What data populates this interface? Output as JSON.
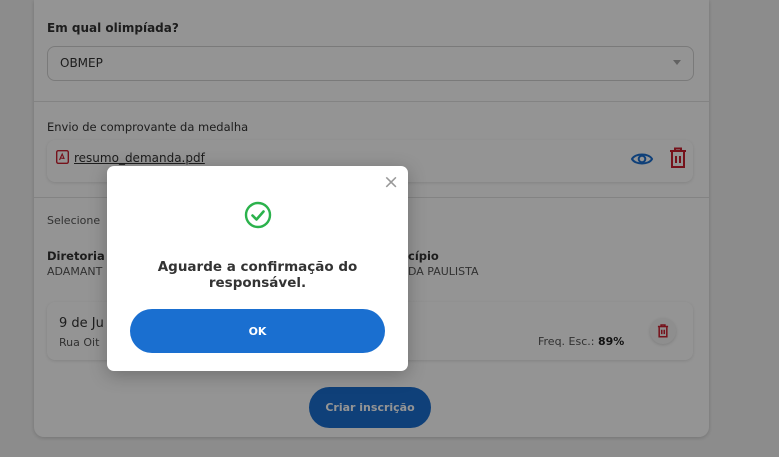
{
  "form": {
    "olympiad_label": "Em qual olimpíada?",
    "olympiad_value": "OBMEP",
    "upload_label": "Envio de comprovante da medalha",
    "file_name": "resumo_demanda.pdf",
    "select_text": "Selecione",
    "diretoria_label": "Diretoria",
    "diretoria_value": "ADAMANT",
    "municipio_label": "cípio",
    "municipio_value": "DA PAULISTA",
    "school": {
      "name": "9 de Ju",
      "address": "Rua Oit",
      "freq_label": "Freq. Esc.: ",
      "freq_value": "89%"
    },
    "create_button": "Criar inscrição"
  },
  "modal": {
    "message": "Aguarde a confirmação do responsável.",
    "ok_button": "OK",
    "close_symbol": "×"
  },
  "colors": {
    "primary": "#1a6fd0",
    "danger": "#cc1f2f",
    "success": "#2bb24c"
  },
  "icons": {
    "success": "check-circle-icon",
    "file": "pdf-file-icon",
    "view": "eye-icon",
    "delete": "trash-icon"
  }
}
